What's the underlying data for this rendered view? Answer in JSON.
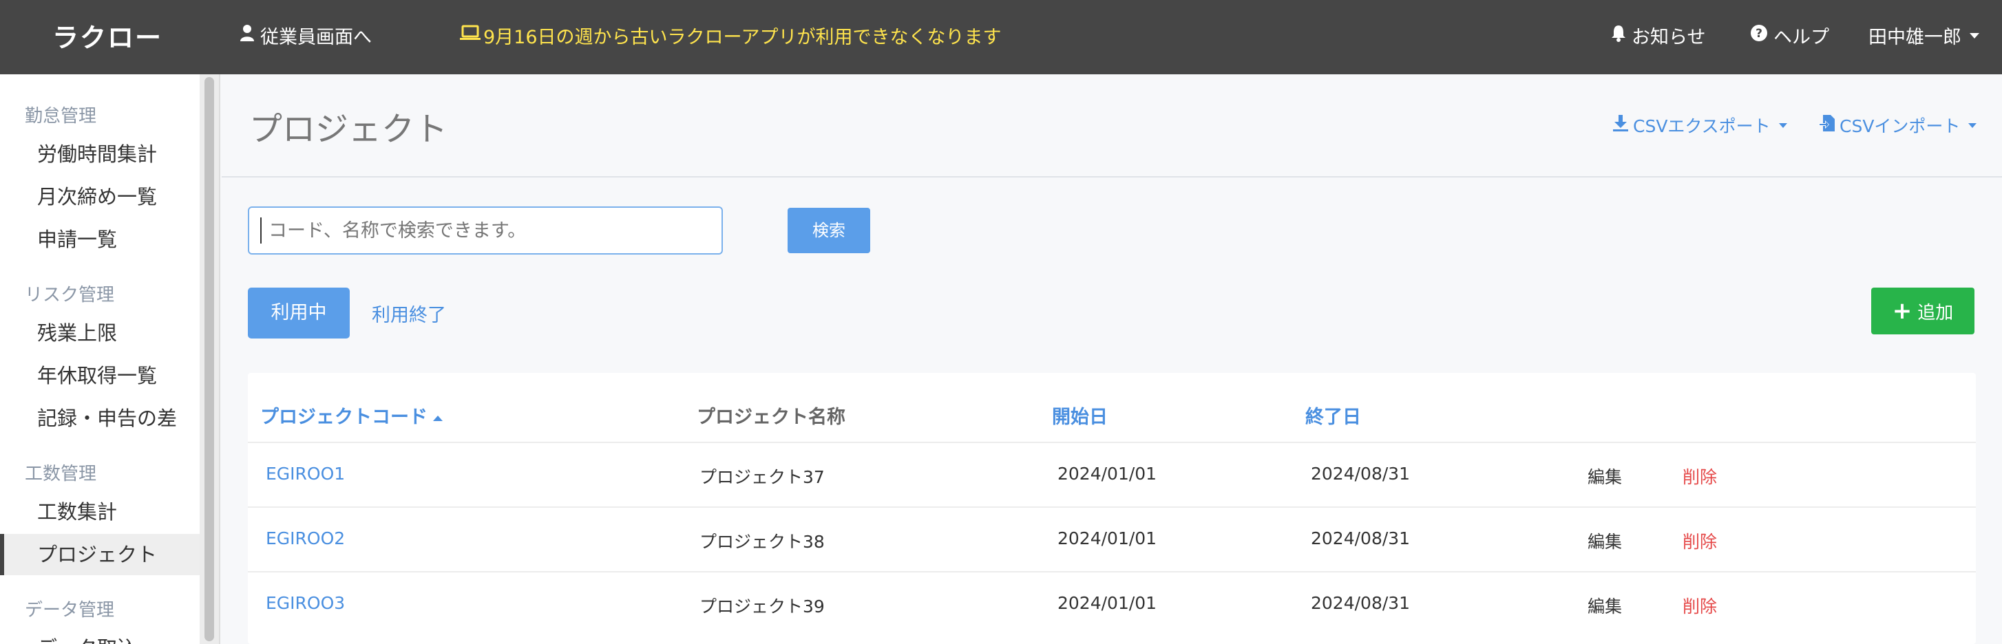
{
  "header": {
    "logo": "ラクロー",
    "employee_link": "従業員画面へ",
    "notice_banner": "9月16日の週から古いラクローアプリが利用できなくなります",
    "notifications": "お知らせ",
    "help": "ヘルプ",
    "user_name": "田中雄一郎"
  },
  "sidebar": {
    "sections": [
      {
        "label": "勤怠管理",
        "items": [
          "労働時間集計",
          "月次締め一覧",
          "申請一覧"
        ]
      },
      {
        "label": "リスク管理",
        "items": [
          "残業上限",
          "年休取得一覧",
          "記録・申告の差"
        ]
      },
      {
        "label": "工数管理",
        "items": [
          "工数集計",
          "プロジェクト"
        ]
      },
      {
        "label": "データ管理",
        "items": [
          "データ取込"
        ]
      }
    ],
    "active_item": "プロジェクト"
  },
  "page": {
    "title": "プロジェクト",
    "csv_export": "CSVエクスポート",
    "csv_import": "CSVインポート"
  },
  "search": {
    "placeholder": "コード、名称で検索できます。",
    "button": "検索"
  },
  "tabs": {
    "active": "利用中",
    "inactive": "利用終了"
  },
  "add_button": "追加",
  "table": {
    "columns": [
      "プロジェクトコード",
      "プロジェクト名称",
      "開始日",
      "終了日"
    ],
    "rows": [
      {
        "code": "EGIROO1",
        "name": "プロジェクト37",
        "start": "2024/01/01",
        "end": "2024/08/31",
        "edit": "編集",
        "delete": "削除"
      },
      {
        "code": "EGIROO2",
        "name": "プロジェクト38",
        "start": "2024/01/01",
        "end": "2024/08/31",
        "edit": "編集",
        "delete": "削除"
      },
      {
        "code": "EGIROO3",
        "name": "プロジェクト39",
        "start": "2024/01/01",
        "end": "2024/08/31",
        "edit": "編集",
        "delete": "削除"
      }
    ]
  },
  "colors": {
    "header_bg": "#464646",
    "notice_text": "#ffe44d",
    "accent_blue": "#5b9ee9",
    "link_blue": "#4a8fe0",
    "add_green": "#28b44a",
    "delete_red": "#e54848"
  }
}
